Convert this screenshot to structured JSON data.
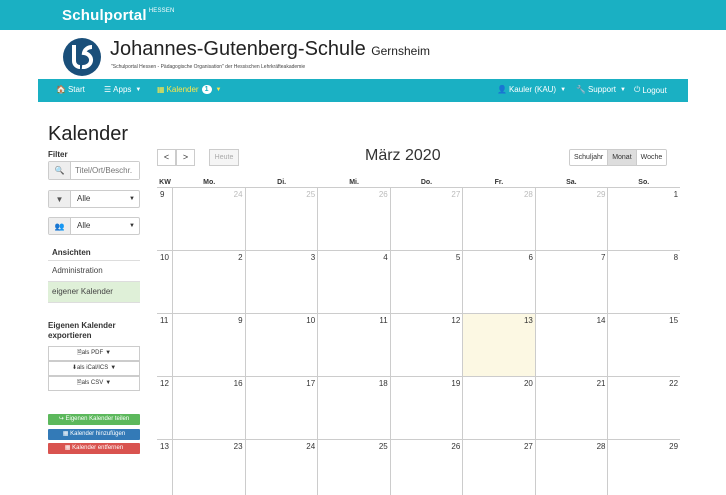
{
  "portal": {
    "title": "Schulportal",
    "superscript": "HESSEN"
  },
  "school": {
    "name": "Johannes-Gutenberg-Schule",
    "location": "Gernsheim",
    "subtitle": "\"Schulportal Hessen - Pädagogische Organisation\" der Hessischen Lehrkräfteakademie"
  },
  "navbar": {
    "start": "Start",
    "apps": "Apps",
    "calendar": "Kalender",
    "calendar_badge": "1",
    "user": "Kauler (KAU)",
    "support": "Support",
    "logout": "Logout"
  },
  "page": {
    "title": "Kalender"
  },
  "sidebar": {
    "filter_label": "Filter",
    "search_placeholder": "Titel/Ort/Beschr.",
    "select_type": "Alle",
    "select_group": "Alle",
    "views_header": "Ansichten",
    "views": [
      "Administration",
      "eigener Kalender"
    ],
    "export_title": "Eigenen Kalender exportieren",
    "export_pdf": "als PDF",
    "export_ical": "als iCal/ICS",
    "export_csv": "als CSV",
    "share_btn": "Eigenen Kalender teilen",
    "add_btn": "Kalender hinzufügen",
    "remove_btn": "Kalender entfernen"
  },
  "calendar": {
    "prev": "<",
    "next": ">",
    "today_btn": "Heute",
    "month_title": "März 2020",
    "view_year": "Schuljahr",
    "view_month": "Monat",
    "view_week": "Woche",
    "kw_header": "KW",
    "weekdays": [
      "Mo.",
      "Di.",
      "Mi.",
      "Do.",
      "Fr.",
      "Sa.",
      "So."
    ],
    "weeks": [
      {
        "kw": "9",
        "days": [
          "24",
          "25",
          "26",
          "27",
          "28",
          "29",
          "1"
        ]
      },
      {
        "kw": "10",
        "days": [
          "2",
          "3",
          "4",
          "5",
          "6",
          "7",
          "8"
        ]
      },
      {
        "kw": "11",
        "days": [
          "9",
          "10",
          "11",
          "12",
          "13",
          "14",
          "15"
        ]
      },
      {
        "kw": "12",
        "days": [
          "16",
          "17",
          "18",
          "19",
          "20",
          "21",
          "22"
        ]
      },
      {
        "kw": "13",
        "days": [
          "23",
          "24",
          "25",
          "26",
          "27",
          "28",
          "29"
        ]
      }
    ]
  },
  "colors": {
    "brand": "#1ab0c3",
    "share": "#5cb85c",
    "add": "#337ab7",
    "remove": "#d9534f",
    "today": "#fcf8e3"
  }
}
